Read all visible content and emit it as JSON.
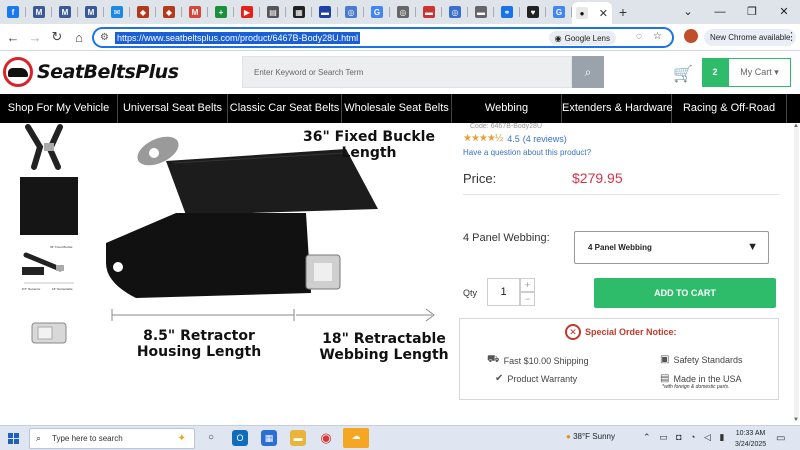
{
  "browser": {
    "tabs": [
      {
        "icon": "facebook-icon",
        "glyph": "f",
        "color": "#1877f2"
      },
      {
        "icon": "site-m-icon",
        "glyph": "M",
        "color": "#3b5998"
      },
      {
        "icon": "site-m-icon",
        "glyph": "M",
        "color": "#3b5998"
      },
      {
        "icon": "site-m-icon",
        "glyph": "M",
        "color": "#3b5998"
      },
      {
        "icon": "chat-icon",
        "glyph": "✉",
        "color": "#1e88e5"
      },
      {
        "icon": "shield-icon",
        "glyph": "◆",
        "color": "#b23a1a"
      },
      {
        "icon": "shield-icon",
        "glyph": "◆",
        "color": "#b23a1a"
      },
      {
        "icon": "gmail-icon",
        "glyph": "M",
        "color": "#d44638"
      },
      {
        "icon": "plus-icon",
        "glyph": "+",
        "color": "#1a8f3c"
      },
      {
        "icon": "youtube-icon",
        "glyph": "▶",
        "color": "#e62117"
      },
      {
        "icon": "page-icon",
        "glyph": "▤",
        "color": "#555"
      },
      {
        "icon": "news-icon",
        "glyph": "▦",
        "color": "#222"
      },
      {
        "icon": "car-icon",
        "glyph": "▬",
        "color": "#1f3fa8"
      },
      {
        "icon": "globe-icon",
        "glyph": "◎",
        "color": "#4a7bd0"
      },
      {
        "icon": "google-icon",
        "glyph": "G",
        "color": "#4285f4"
      },
      {
        "icon": "globe-icon",
        "glyph": "◎",
        "color": "#666"
      },
      {
        "icon": "page-icon",
        "glyph": "▬",
        "color": "#c33"
      },
      {
        "icon": "globe-icon",
        "glyph": "◎",
        "color": "#3a6fd0"
      },
      {
        "icon": "car-icon",
        "glyph": "▬",
        "color": "#666"
      },
      {
        "icon": "link-icon",
        "glyph": "⚭",
        "color": "#1a73e8"
      },
      {
        "icon": "heart-icon",
        "glyph": "♥",
        "color": "#222"
      },
      {
        "icon": "google-icon",
        "glyph": "G",
        "color": "#4285f4"
      }
    ],
    "active_tab_icon": "seatbelts-tab-icon",
    "active_tab_close": "✕",
    "new_tab": "+",
    "tab_search": "⌄",
    "window_controls": {
      "minimize": "—",
      "restore": "❐",
      "close": "✕"
    },
    "nav": {
      "back": "←",
      "forward": "→",
      "reload": "↻",
      "home": "⌂"
    },
    "url": "https://www.seatbeltsplus.com/product/6467B-Body28U.html",
    "lens_label": "Google Lens",
    "chrome_available": "New Chrome available",
    "menu": "⋮"
  },
  "site": {
    "logo_text": "SeatBeltsPlus",
    "search_placeholder": "Enter Keyword or Search Term",
    "search_icon": "⌕",
    "cart_glyph": "🛒",
    "cart_count": "2",
    "my_cart": "My Cart ▾",
    "nav": [
      {
        "label": "Shop For My Vehicle",
        "width": 118
      },
      {
        "label": "Universal Seat Belts",
        "width": 110
      },
      {
        "label": "Classic Car Seat Belts",
        "width": 114
      },
      {
        "label": "Wholesale Seat Belts",
        "width": 110
      },
      {
        "label": "Webbing",
        "width": 110
      },
      {
        "label": "Extenders & Hardware",
        "width": 110
      },
      {
        "label": "Racing & Off-Road",
        "width": 115
      }
    ]
  },
  "product": {
    "code": "Code: 6467B-Body28U",
    "stars": "★★★★½",
    "rating": "4.5",
    "reviews": "(4 reviews)",
    "question": "Have a question about this product?",
    "price_label": "Price:",
    "price": "$279.95",
    "webbing_label": "4 Panel Webbing:",
    "webbing_value": "4 Panel Webbing",
    "qty_label": "Qty",
    "qty_value": "1",
    "qty_up": "+",
    "qty_down": "−",
    "add_to_cart": "ADD TO CART",
    "notice": "Special Order Notice:",
    "features": {
      "shipping": "Fast $10.00 Shipping",
      "safety": "Safety Standards",
      "warranty": "Product Warranty",
      "made": "Made in the USA",
      "made_sub": "*with foreign & domestic parts."
    },
    "image_text": {
      "fixed_buckle": "36\" Fixed Buckle\nLength",
      "retractor": "8.5\" Retractor\nHousing Length",
      "retractable": "18\" Retractable\nWebbing Length"
    },
    "thumb3_caps": [
      "36\" Fixed Buckle",
      "8.5\" Retractor",
      "18\" Retractable"
    ]
  },
  "taskbar": {
    "search_placeholder": "Type here to search",
    "weather_temp": "38°F",
    "weather_cond": "Sunny",
    "time": "10:33 AM",
    "date": "3/24/2025"
  }
}
